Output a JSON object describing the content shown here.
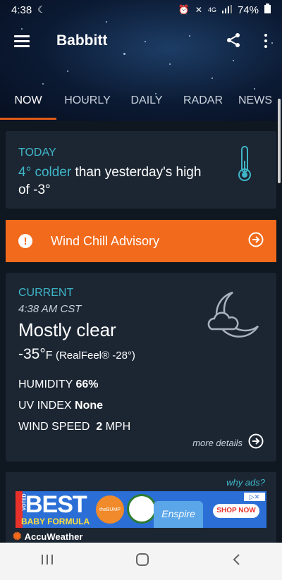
{
  "status_bar": {
    "time": "4:38",
    "battery": "74%",
    "network": "4G LTE"
  },
  "app": {
    "location": "Babbitt"
  },
  "tabs": [
    {
      "label": "NOW",
      "active": true
    },
    {
      "label": "HOURLY"
    },
    {
      "label": "DAILY"
    },
    {
      "label": "RADAR"
    },
    {
      "label": "NEWS"
    }
  ],
  "today": {
    "heading": "TODAY",
    "highlight": "4° colder",
    "rest_line1": " than yesterday's high",
    "rest_line2": "of -3°"
  },
  "advisory": {
    "label": "Wind Chill Advisory"
  },
  "current": {
    "heading": "CURRENT",
    "time": "4:38 AM CST",
    "condition": "Mostly clear",
    "temp": "-35°",
    "unit": "F",
    "realfeel": "(RealFeel® -28°)",
    "humidity_label": "HUMIDITY",
    "humidity_value": "66%",
    "uv_label": "UV INDEX",
    "uv_value": "None",
    "wind_label": "WIND SPEED",
    "wind_value": "2",
    "wind_unit": "MPH",
    "more_details": "more details"
  },
  "ad": {
    "why_ads": "why ads?",
    "voted": "VOTED",
    "best": "BEST",
    "baby_formula": "BABY FORMULA",
    "bump": "theBUMP",
    "product": "Enspire",
    "shop_now": "SHOP NOW",
    "accuweather": "AccuWeather"
  },
  "colors": {
    "accent": "#e05a16",
    "teal": "#3fb6c7",
    "advisory": "#f26a1b"
  }
}
